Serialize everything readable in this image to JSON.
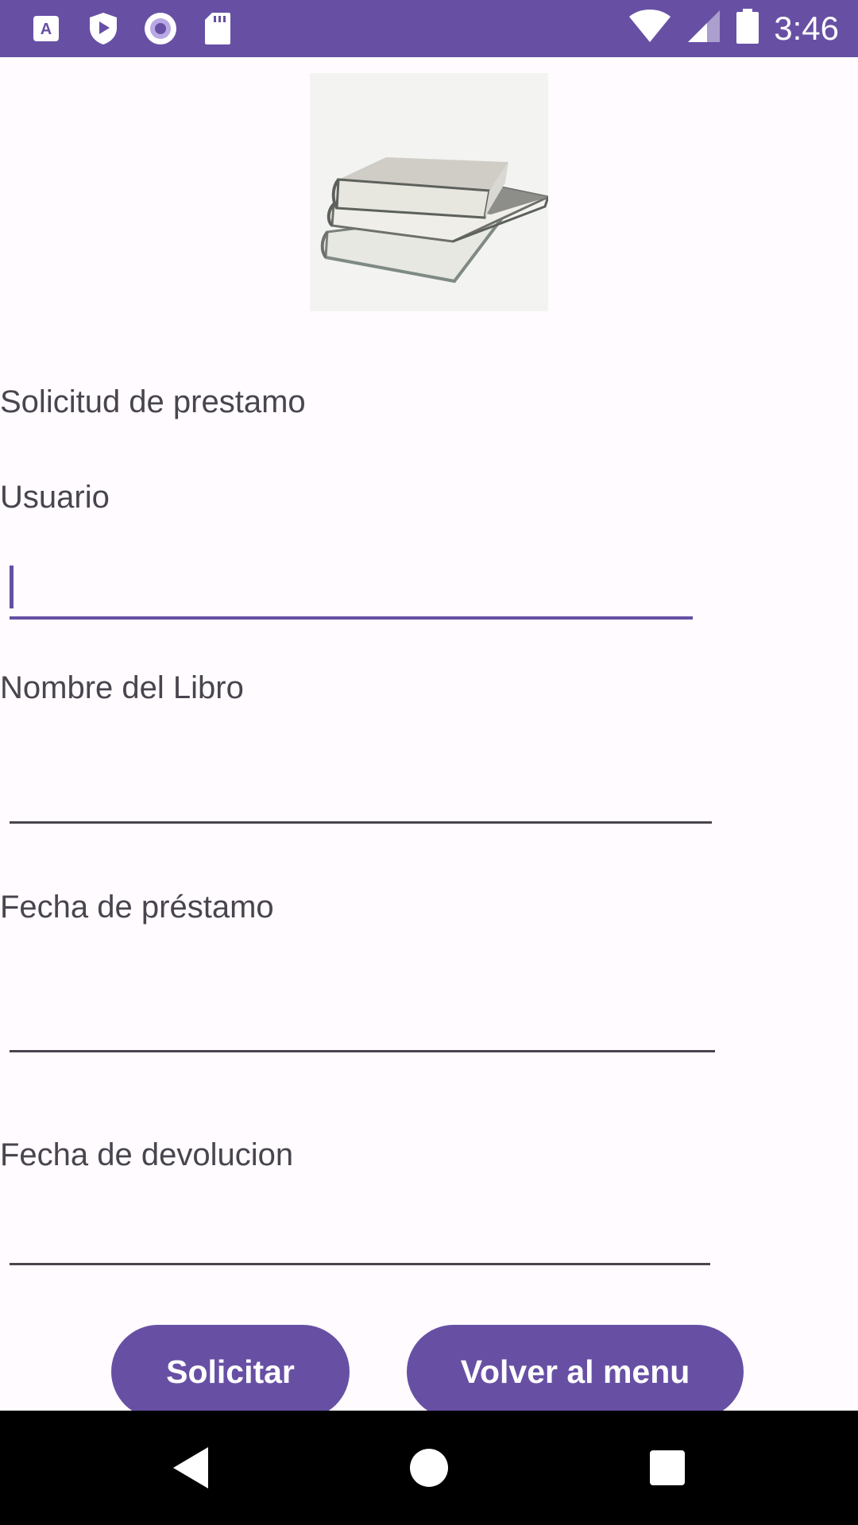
{
  "status_bar": {
    "time": "3:46",
    "background": "#6750a4",
    "left_icons": [
      "keyboard-a-icon",
      "play-shield-icon",
      "record-circle-icon",
      "sd-card-icon"
    ],
    "right_icons": [
      "wifi-icon",
      "signal-icon",
      "battery-icon"
    ]
  },
  "hero_image": {
    "icon": "books-stack-image"
  },
  "form": {
    "title": "Solicitud de prestamo",
    "usuario_label": "Usuario",
    "usuario_value": "",
    "libro_label": "Nombre del Libro",
    "libro_value": "",
    "fecha_prestamo_label": "Fecha de préstamo",
    "fecha_prestamo_value": "",
    "fecha_devolucion_label": "Fecha de devolucion",
    "fecha_devolucion_value": ""
  },
  "buttons": {
    "solicitar": "Solicitar",
    "volver": "Volver al menu",
    "color": "#6750a4"
  },
  "nav_bar": {
    "icons": [
      "back-icon",
      "home-icon",
      "recents-icon"
    ]
  }
}
